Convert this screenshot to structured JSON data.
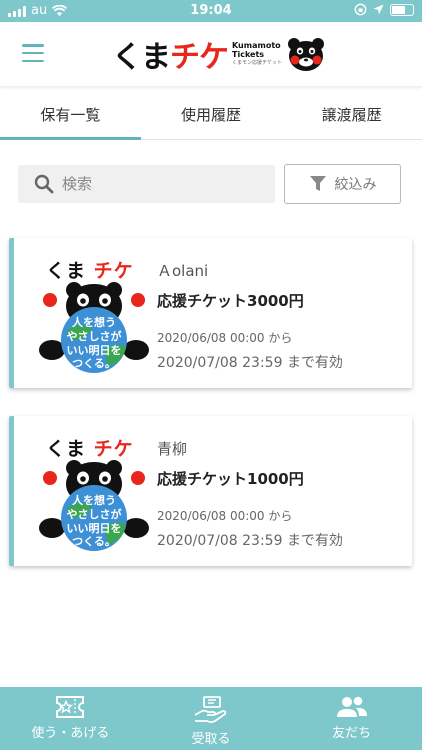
{
  "status_bar": {
    "carrier": "au",
    "time": "19:04"
  },
  "header": {
    "logo_main_1": "くま",
    "logo_main_2": "チケ",
    "logo_sub_1": "Kumamoto",
    "logo_sub_2": "Tickets",
    "logo_sub_tiny": "くまモン応援チケット"
  },
  "tabs": [
    {
      "label": "保有一覧",
      "active": true
    },
    {
      "label": "使用履歴",
      "active": false
    },
    {
      "label": "譲渡履歴",
      "active": false
    }
  ],
  "search": {
    "placeholder": "検索"
  },
  "filter": {
    "label": "絞込み"
  },
  "thumb": {
    "title_1": "くま",
    "title_2": "チケ",
    "globe_line_1": "人を想う",
    "globe_line_2": "やさしさが",
    "globe_line_3": "いい明日を",
    "globe_line_4": "つくる。"
  },
  "tickets": [
    {
      "issuer": "Ａolani",
      "name": "応援チケット3000円",
      "valid_from": "2020/06/08 00:00 から",
      "valid_until": "2020/07/08 23:59 まで有効"
    },
    {
      "issuer": "青柳",
      "name": "応援チケット1000円",
      "valid_from": "2020/06/08 00:00 から",
      "valid_until": "2020/07/08 23:59 まで有効"
    }
  ],
  "bottom_nav": [
    {
      "label": "使う・あげる",
      "icon": "ticket-star-icon"
    },
    {
      "label": "受取る",
      "icon": "receive-hand-icon"
    },
    {
      "label": "友だち",
      "icon": "friends-icon"
    }
  ],
  "colors": {
    "accent": "#7ec8cc",
    "accent_dark": "#5fb5ba",
    "brand_red": "#e8261c"
  }
}
